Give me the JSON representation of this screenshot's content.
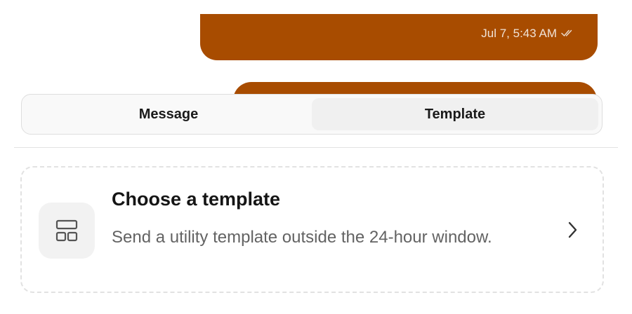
{
  "chat": {
    "outgoing_message_1": {
      "timestamp": "Jul 7, 5:43 AM",
      "status_icon": "double-check-icon"
    }
  },
  "tabs": [
    {
      "label": "Message",
      "active": false
    },
    {
      "label": "Template",
      "active": true
    }
  ],
  "template_card": {
    "icon": "layout-template-icon",
    "title": "Choose a template",
    "description": "Send a utility template outside the 24-hour window.",
    "action_icon": "chevron-right-icon"
  },
  "colors": {
    "outgoing_bubble": "#a84c00",
    "text_primary": "#151515",
    "text_secondary": "#636363"
  }
}
